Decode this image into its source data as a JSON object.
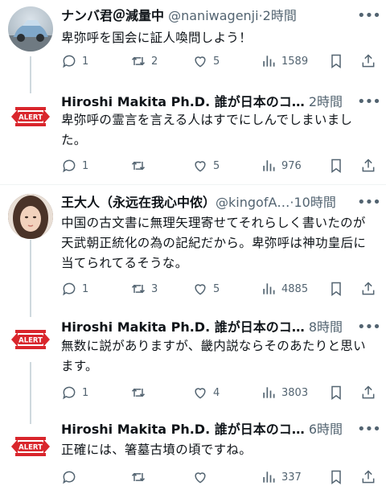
{
  "tweets": [
    {
      "name": "ナンバ君＠減量中",
      "handle": "@naniwagenji",
      "time": "2時間",
      "text": "卑弥呼を国会に証人喚問しよう！",
      "replies": "1",
      "retweets": "2",
      "likes": "5",
      "views": "1589"
    },
    {
      "name": "Hiroshi Makita Ph.D. 誰が日本のコ…",
      "handle": "",
      "time": "2時間",
      "text": "卑弥呼の霊言を言える人はすでにしんでしまいました。",
      "replies": "1",
      "retweets": "",
      "likes": "5",
      "views": "976"
    },
    {
      "name": "王大人（永远在我心中侬）",
      "handle": "@kingofA…",
      "time": "10時間",
      "text": "中国の古文書に無理矢理寄せてそれらしく書いたのが天武朝正統化の為の記紀だから。卑弥呼は神功皇后に当てられてるそうな。",
      "replies": "1",
      "retweets": "3",
      "likes": "5",
      "views": "4885"
    },
    {
      "name": "Hiroshi Makita Ph.D. 誰が日本のコ…",
      "handle": "",
      "time": "8時間",
      "text": "無数に説がありますが、畿内説ならそのあたりと思います。",
      "replies": "1",
      "retweets": "",
      "likes": "4",
      "views": "3803"
    },
    {
      "name": "Hiroshi Makita Ph.D. 誰が日本のコ…",
      "handle": "",
      "time": "6時間",
      "text": "正確には、箸墓古墳の頃ですね。",
      "replies": "",
      "retweets": "",
      "likes": "",
      "views": "337"
    }
  ],
  "alert_logo_text": "ALERT",
  "icons": [
    "more-icon",
    "reply-icon",
    "retweet-icon",
    "like-icon",
    "views-icon",
    "bookmark-icon",
    "share-icon"
  ],
  "colors": {
    "text": "#0f1419",
    "muted": "#536471",
    "alert_red": "#d9262c",
    "thread_line": "#cfd9de"
  }
}
